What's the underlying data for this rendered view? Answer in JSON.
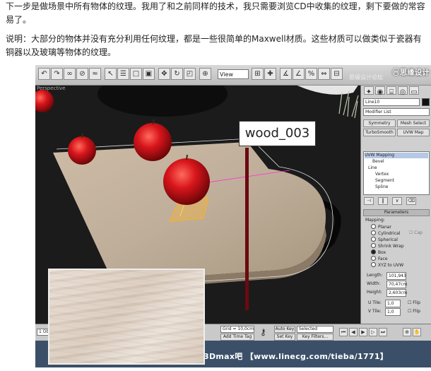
{
  "article": {
    "para1": "下一步是做场景中所有物体的纹理。我用了和之前同样的技术，我只需要浏览CD中收集的纹理，剩下要做的常容易了。",
    "para2": "说明：大部分的物体并没有充分利用任何纹理，都是一些很简单的Maxwell材质。这些材质可以做类似于瓷器有铜器以及玻璃等物体的纹理。"
  },
  "screenshot": {
    "toolbar": {
      "view_dropdown": "View",
      "watermark_logo": "ⓜ思缘设计",
      "watermark_sub": "思缘设计论坛"
    },
    "viewport": {
      "label": "Perspective",
      "material_label": "wood_003"
    },
    "command_panel": {
      "object_name": "Line10",
      "modifier_list": "Modifier List",
      "buttons": [
        "Symmetry",
        "Mesh Select",
        "TurboSmooth",
        "UVW Map"
      ],
      "stack": [
        "UVW Mapping",
        "Bevel",
        "Line",
        "Vertex",
        "Segment",
        "Spline"
      ],
      "parameters_title": "Parameters",
      "mapping_label": "Mapping:",
      "mapping_options": [
        "Planar",
        "Cylindrical",
        "Spherical",
        "Shrink Wrap",
        "Box",
        "Face",
        "XYZ to UVW"
      ],
      "mapping_selected": "Box",
      "cap_label": "Cap",
      "length_label": "Length:",
      "length_value": "101,943",
      "width_label": "Width:",
      "width_value": "70,47cm",
      "height_label": "Height:",
      "height_value": "2,603cm",
      "utile_label": "U Tile:",
      "utile_value": "1,0",
      "vtile_label": "V Tile:",
      "vtile_value": "1,0",
      "flip_label": "Flip"
    },
    "status": {
      "selection_count": "1 Ob",
      "grid": "Grid = 10,0cm",
      "add_time_tag": "Add Time Tag",
      "auto_key": "Auto Key",
      "set_key": "Set Key",
      "selected": "Selected",
      "key_filters": "Key Filters..."
    },
    "brand_banner": "3Dmax吧 【www.linecg.com/tieba/1771】"
  },
  "colors": {
    "apple_red": "#c8141a",
    "wood": "#c9b7a2",
    "viewport_bg": "#1b1b1b",
    "banner_bg": "#3b5068"
  }
}
